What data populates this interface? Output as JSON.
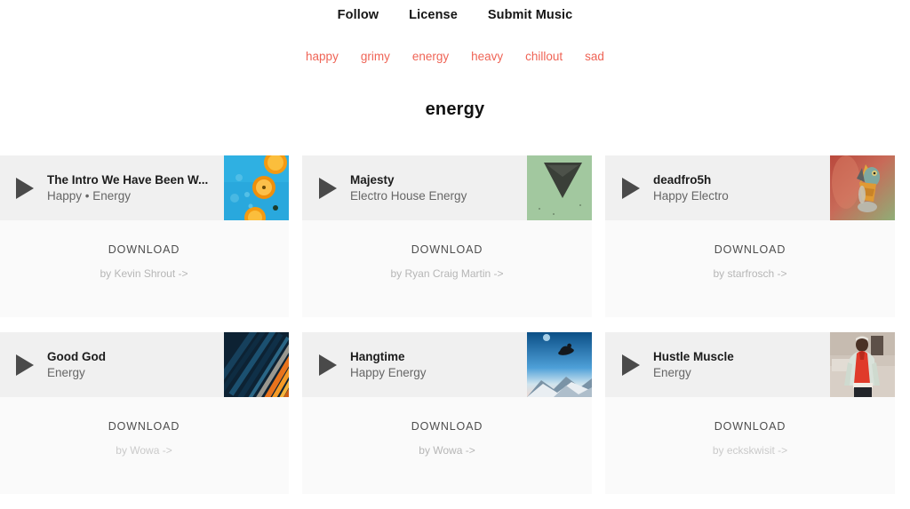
{
  "nav": {
    "items": [
      {
        "label": "Follow"
      },
      {
        "label": "License"
      },
      {
        "label": "Submit Music"
      }
    ]
  },
  "tags": [
    {
      "label": "happy"
    },
    {
      "label": "grimy"
    },
    {
      "label": "energy"
    },
    {
      "label": "heavy"
    },
    {
      "label": "chillout"
    },
    {
      "label": "sad"
    }
  ],
  "page": {
    "title": "energy",
    "accent_color": "#ef6456",
    "card_header_bg": "#f0f0f0",
    "card_body_bg": "#fafafa",
    "play_icon_color": "#4a4a4a"
  },
  "tracks": [
    {
      "title": "The Intro We Have Been W...",
      "subtitle": "Happy • Energy",
      "download_label": "DOWNLOAD",
      "by_label": "by Kevin Shrout ->",
      "by_dim": false,
      "artwork": "oranges-on-blue"
    },
    {
      "title": "Majesty",
      "subtitle": "Electro House Energy",
      "download_label": "DOWNLOAD",
      "by_label": "by Ryan Craig Martin ->",
      "by_dim": false,
      "artwork": "green-triangle"
    },
    {
      "title": "deadfro5h",
      "subtitle": "Happy Electro",
      "download_label": "DOWNLOAD",
      "by_label": "by starfrosch ->",
      "by_dim": false,
      "artwork": "colorful-frog"
    },
    {
      "title": "Good God",
      "subtitle": "Energy",
      "download_label": "DOWNLOAD",
      "by_label": "by Wowa ->",
      "by_dim": true,
      "artwork": "blue-orange-streaks"
    },
    {
      "title": "Hangtime",
      "subtitle": "Happy Energy",
      "download_label": "DOWNLOAD",
      "by_label": "by Wowa ->",
      "by_dim": false,
      "artwork": "snowboarder-sky"
    },
    {
      "title": "Hustle Muscle",
      "subtitle": "Energy",
      "download_label": "DOWNLOAD",
      "by_label": "by eckskwisit ->",
      "by_dim": true,
      "artwork": "red-hoodie-person"
    }
  ]
}
